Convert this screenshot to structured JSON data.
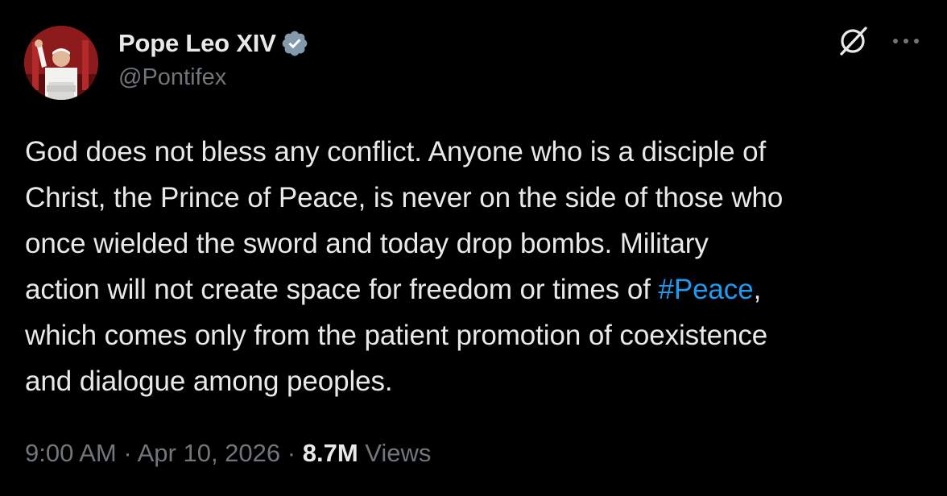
{
  "author": {
    "display_name": "Pope Leo XIV",
    "handle": "@Pontifex",
    "verified_icon": "verified-badge-icon",
    "verified_color": "#829aab"
  },
  "header_actions": {
    "grok_icon": "grok-slash-icon",
    "more_icon": "more-dots-icon"
  },
  "tweet": {
    "lines": [
      "God does not bless any conflict. Anyone who is a disciple of",
      "Christ, the Prince of Peace, is never on the side of those who",
      "once wielded the sword and today drop bombs. Military",
      "action will not create space for freedom or times of ",
      "which comes only from the patient promotion of coexistence",
      "and dialogue among peoples."
    ],
    "hashtag": "#Peace",
    "after_hashtag": ","
  },
  "meta": {
    "time": "9:00 AM",
    "separator": "·",
    "date": "Apr 10, 2026",
    "views_count": "8.7M",
    "views_label": "Views"
  },
  "colors": {
    "background": "#000000",
    "text": "#e7e9ea",
    "secondary": "#71767b",
    "link": "#1d9bf0"
  }
}
